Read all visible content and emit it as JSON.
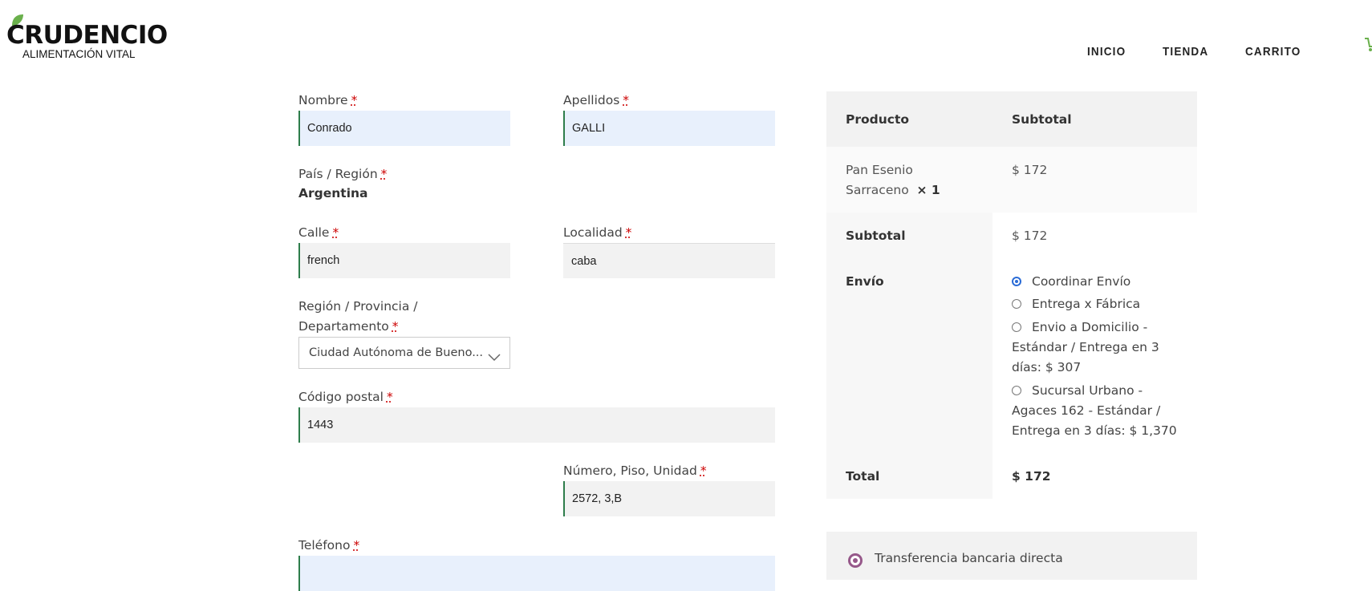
{
  "brand": {
    "name": "CRUDENCIO",
    "tagline": "ALIMENTACIÓN VITAL"
  },
  "nav": {
    "items": [
      "INICIO",
      "TIENDA",
      "CARRITO"
    ]
  },
  "form": {
    "required_mark": "*",
    "nombre": {
      "label": "Nombre",
      "value": "Conrado"
    },
    "apellidos": {
      "label": "Apellidos",
      "value": "GALLI"
    },
    "pais": {
      "label": "País / Región",
      "value": "Argentina"
    },
    "calle": {
      "label": "Calle",
      "value": "french"
    },
    "localidad": {
      "label": "Localidad",
      "value": "caba"
    },
    "region": {
      "label_line1": "Región / Provincia /",
      "label_line2": "Departamento",
      "value": "Ciudad Autónoma de Bueno..."
    },
    "codigo_postal": {
      "label": "Código postal",
      "value": "1443"
    },
    "numero": {
      "label": "Número, Piso, Unidad",
      "value": "2572, 3,B"
    },
    "telefono": {
      "label": "Teléfono",
      "value": ""
    }
  },
  "order": {
    "col_product": "Producto",
    "col_subtotal": "Subtotal",
    "item_name_line1": "Pan Esenio",
    "item_name_line2": "Sarraceno",
    "item_qty": "× 1",
    "item_price": "$ 172",
    "subtotal_label": "Subtotal",
    "subtotal_value": "$ 172",
    "shipping_label": "Envío",
    "shipping_options": [
      {
        "lines": [
          "Coordinar Envío"
        ],
        "selected": true
      },
      {
        "lines": [
          "Entrega x Fábrica"
        ],
        "selected": false
      },
      {
        "lines": [
          "Envio a Domicilio -",
          "Estándar / Entrega en 3",
          "días: $ 307"
        ],
        "selected": false
      },
      {
        "lines": [
          "Sucursal Urbano -",
          "Agaces 162 - Estándar /",
          "Entrega en 3 días: $ 1,370"
        ],
        "selected": false
      }
    ],
    "total_label": "Total",
    "total_value": "$ 172"
  },
  "payment": {
    "method": "Transferencia bancaria directa",
    "selected": true
  },
  "colors": {
    "accent_green": "#2e7d4b",
    "radio_blue": "#2a6bd6",
    "payment_purple": "#96588a",
    "required_red": "#c00"
  },
  "icons": [
    "leaf-icon",
    "cart-icon",
    "chevron-down-icon"
  ]
}
